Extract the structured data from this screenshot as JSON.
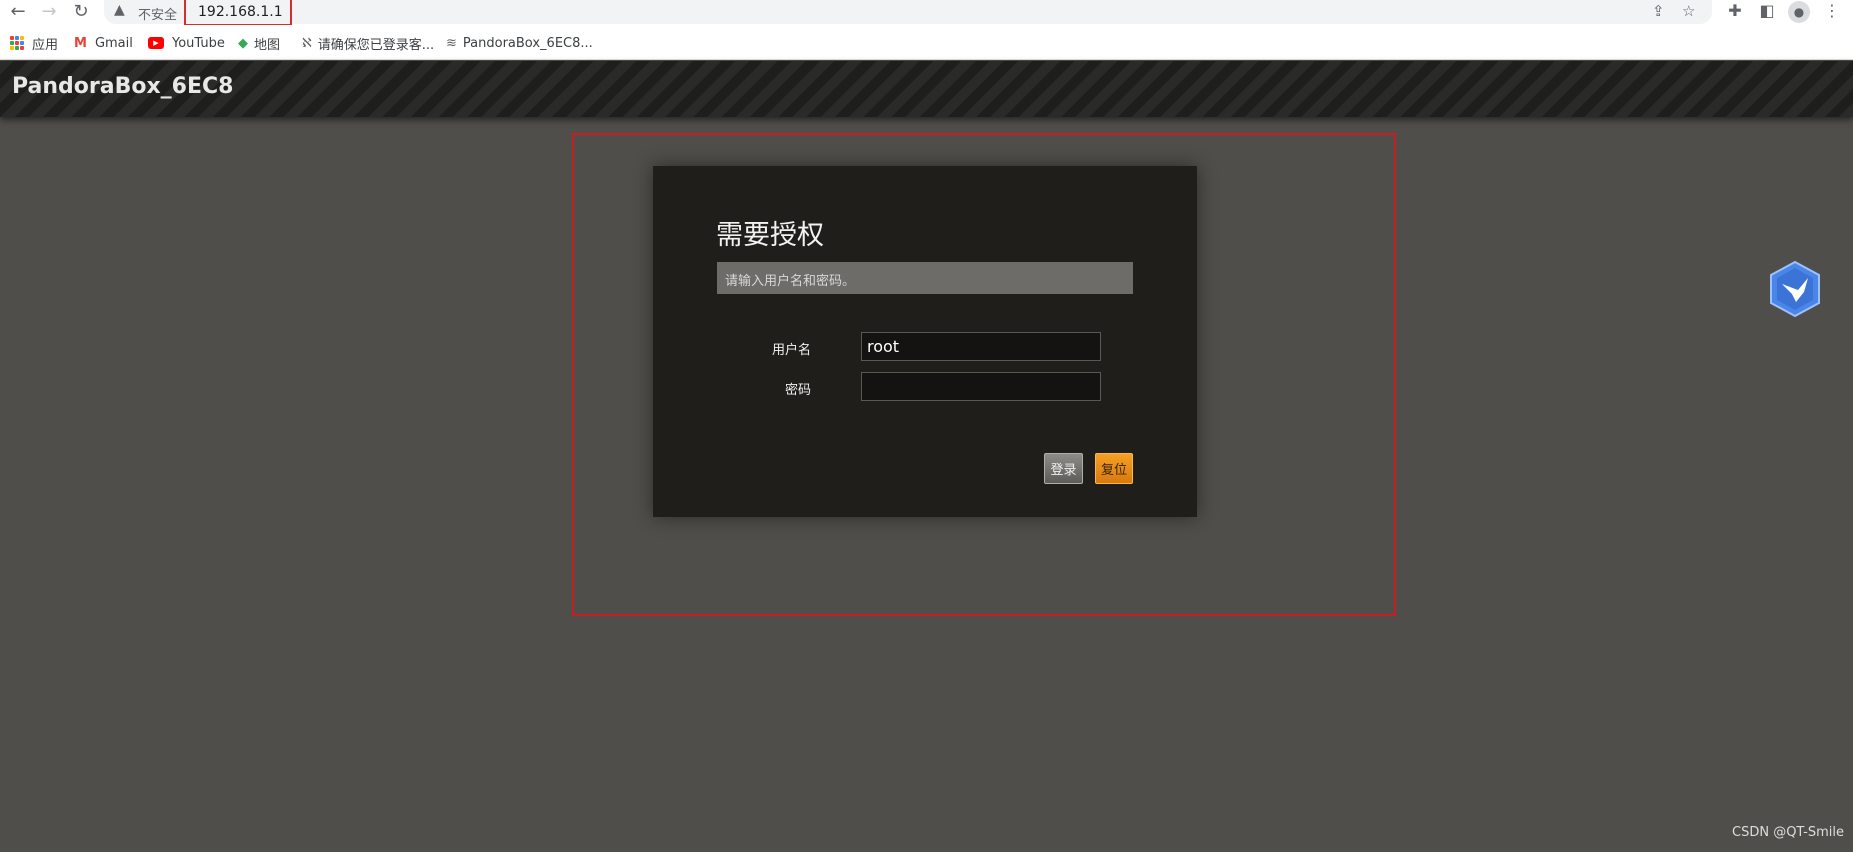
{
  "browser": {
    "url": "192.168.1.1",
    "security_label": "不安全",
    "bookmarks": [
      {
        "label": "应用",
        "icon": "apps-grid-icon"
      },
      {
        "label": "Gmail",
        "icon": "gmail-icon"
      },
      {
        "label": "YouTube",
        "icon": "youtube-icon"
      },
      {
        "label": "地图",
        "icon": "maps-icon"
      },
      {
        "label": "请确保您已登录客...",
        "icon": "bookmark-app-icon"
      },
      {
        "label": "PandoraBox_6EC8...",
        "icon": "router-icon"
      }
    ]
  },
  "header": {
    "title": "PandoraBox_6EC8"
  },
  "login": {
    "title": "需要授权",
    "message": "请输入用户名和密码。",
    "username_label": "用户名",
    "username_value": "root",
    "password_label": "密码",
    "password_value": "",
    "login_button": "登录",
    "reset_button": "复位"
  },
  "colors": {
    "page_bg": "#504e4a",
    "panel_bg": "#1f1e1b",
    "accent_orange": "#f08c1a",
    "annotation_red": "#c81e1e"
  },
  "watermark": "CSDN @QT-Smile"
}
